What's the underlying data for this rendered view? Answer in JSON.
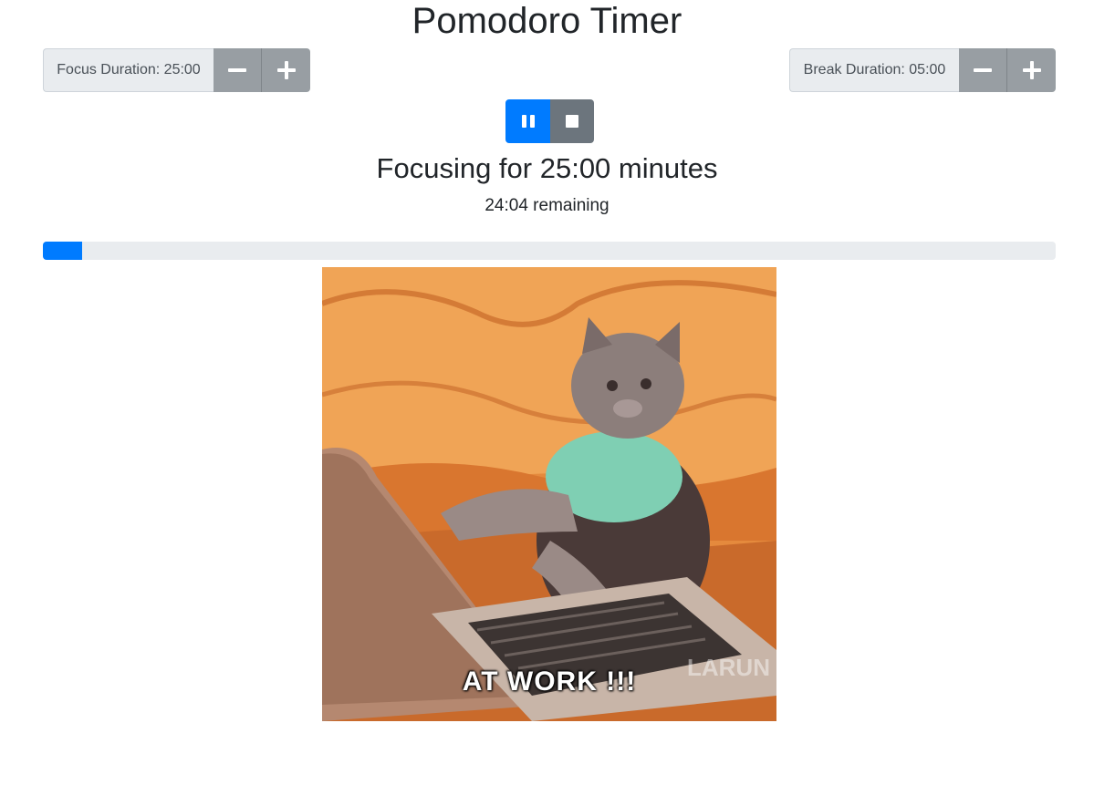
{
  "title": "Pomodoro Timer",
  "focus": {
    "label": "Focus Duration: 25:00",
    "minus_icon": "minus-icon",
    "plus_icon": "plus-icon"
  },
  "break": {
    "label": "Break Duration: 05:00",
    "minus_icon": "minus-icon",
    "plus_icon": "plus-icon"
  },
  "controls": {
    "pause_icon": "pause-icon",
    "stop_icon": "stop-icon"
  },
  "status": {
    "heading": "Focusing for 25:00 minutes",
    "remaining": "24:04 remaining"
  },
  "progress": {
    "percent": 3.9
  },
  "image": {
    "caption": "AT WORK !!!",
    "subject": "cat typing on laptop"
  },
  "colors": {
    "primary": "#007bff",
    "secondary": "#6c757d",
    "track": "#e9ecef"
  }
}
